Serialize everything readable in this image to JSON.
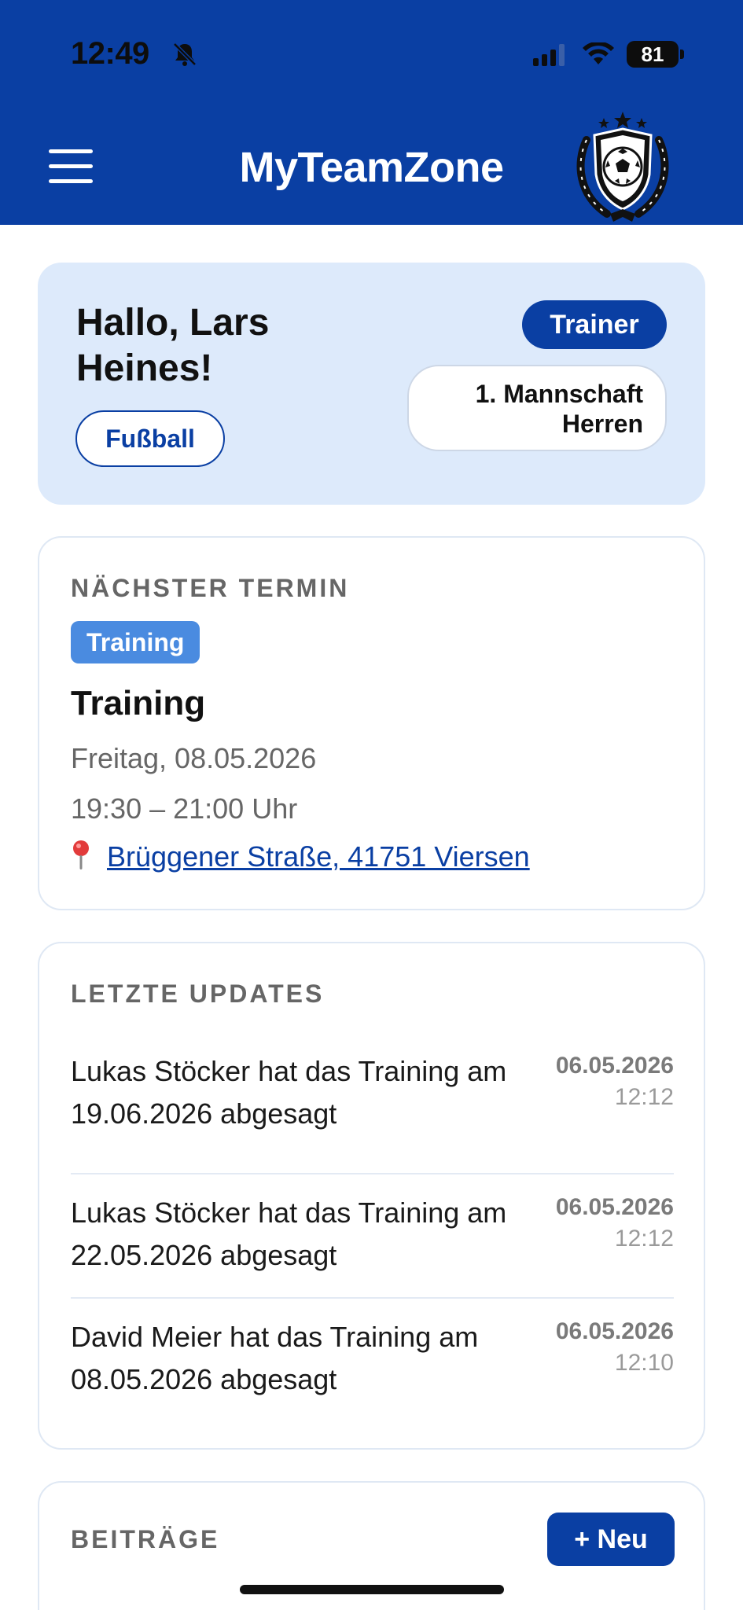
{
  "status_bar": {
    "time": "12:49",
    "battery": "81"
  },
  "header": {
    "title": "MyTeamZone",
    "menu_icon": "hamburger-icon",
    "logo_icon": "football-crest-logo"
  },
  "greeting": {
    "hello": "Hallo, Lars Heines!",
    "sport": "Fußball",
    "role": "Trainer",
    "team_line1": "1. Mannschaft",
    "team_line2": "Herren"
  },
  "next_event": {
    "section_label": "NÄCHSTER TERMIN",
    "type_badge": "Training",
    "title": "Training",
    "date": "Freitag, 08.05.2026",
    "time": "19:30 – 21:00 Uhr",
    "location": "Brüggener Straße, 41751 Viersen",
    "location_icon": "map-pin-icon"
  },
  "updates": {
    "section_label": "LETZTE UPDATES",
    "items": [
      {
        "text": "Lukas Stöcker hat das Training am 19.06.2026 abgesagt",
        "date": "06.05.2026",
        "time": "12:12"
      },
      {
        "text": "Lukas Stöcker hat das Training am 22.05.2026 abgesagt",
        "date": "06.05.2026",
        "time": "12:12"
      },
      {
        "text": "David Meier hat das Training am 08.05.2026 abgesagt",
        "date": "06.05.2026",
        "time": "12:10"
      }
    ]
  },
  "posts": {
    "section_label": "BEITRÄGE",
    "new_button": "+ Neu"
  },
  "colors": {
    "brand": "#0a3fa3",
    "badge": "#4a8be0",
    "greet_bg": "#ddeafb"
  }
}
